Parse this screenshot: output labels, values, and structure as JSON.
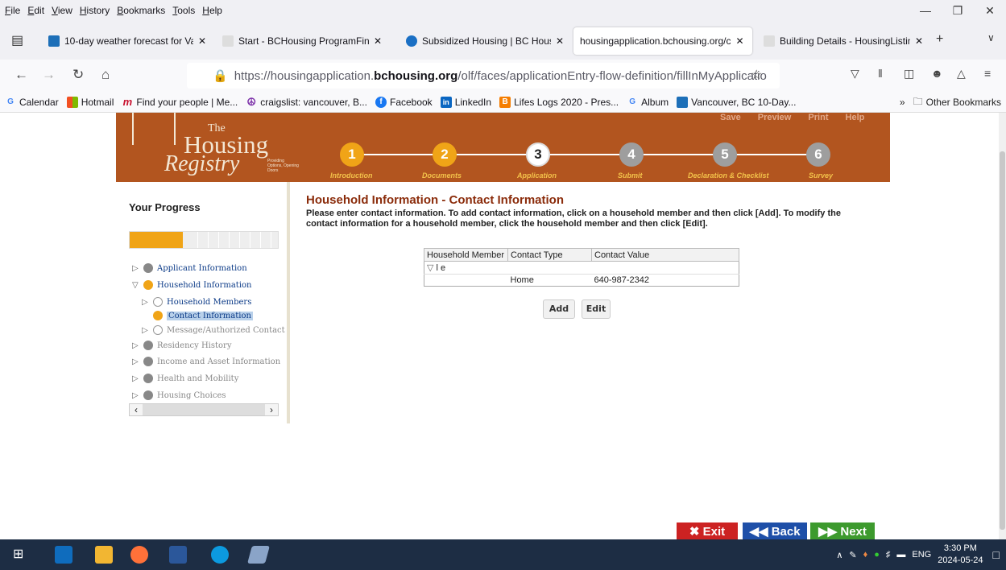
{
  "menubar": {
    "items": [
      "File",
      "Edit",
      "View",
      "History",
      "Bookmarks",
      "Tools",
      "Help"
    ]
  },
  "tabs": [
    {
      "title": "10-day weather forecast for Van",
      "color": "#1d6fb8"
    },
    {
      "title": "Start - BCHousing ProgramFind",
      "color": "#aaaaaa"
    },
    {
      "title": "Subsidized Housing | BC Housin",
      "color": "#1a6fc4"
    },
    {
      "title": "housingapplication.bchousing.org/c",
      "color": "#ffffff"
    },
    {
      "title": "Building Details - HousingListin",
      "color": "#aaaaaa"
    }
  ],
  "url": {
    "prefix": "https://housingapplication.",
    "domain": "bchousing.org",
    "path": "/olf/faces/applicationEntry-flow-definition/fillInMyApplicatio"
  },
  "bookmarks": [
    {
      "label": "Calendar",
      "icon": "G",
      "color": "#4285f4"
    },
    {
      "label": "Hotmail",
      "icon": "",
      "color": "#f25022"
    },
    {
      "label": "Find your people | Me...",
      "icon": "m",
      "color": "#c8102e"
    },
    {
      "label": "craigslist: vancouver, B...",
      "icon": "☮",
      "color": "#7b2fa8"
    },
    {
      "label": "Facebook",
      "icon": "f",
      "color": "#1877f2"
    },
    {
      "label": "LinkedIn",
      "icon": "in",
      "color": "#0a66c2"
    },
    {
      "label": "Lifes Logs 2020 - Pres...",
      "icon": "B",
      "color": "#f57d00"
    },
    {
      "label": "Album",
      "icon": "G",
      "color": "#4285f4"
    },
    {
      "label": "Vancouver, BC 10-Day...",
      "icon": "",
      "color": "#1d6fb8"
    }
  ],
  "other_bookmarks": "Other Bookmarks",
  "banner": {
    "logo_the": "The",
    "logo_housing": "Housing",
    "logo_registry": "Registry",
    "logo_tagline": "Providing Options, Opening Doors",
    "top_links": [
      "Save",
      "Preview",
      "Print",
      "Help"
    ]
  },
  "steps": [
    {
      "num": "1",
      "label": "Introduction",
      "state": "done"
    },
    {
      "num": "2",
      "label": "Documents",
      "state": "done"
    },
    {
      "num": "3",
      "label": "Application",
      "state": "current"
    },
    {
      "num": "4",
      "label": "Submit",
      "state": "todo"
    },
    {
      "num": "5",
      "label": "Declaration & Checklist",
      "state": "todo"
    },
    {
      "num": "6",
      "label": "Survey",
      "state": "todo"
    }
  ],
  "sidebar": {
    "title": "Your Progress",
    "progress_fraction": 0.36,
    "items": [
      "Applicant Information",
      "Household Information",
      "Household Members",
      "Contact Information",
      "Message/Authorized Contact",
      "Residency History",
      "Income and Asset Information",
      "Health and Mobility",
      "Housing Choices"
    ]
  },
  "main": {
    "title": "Household Information - Contact Information",
    "instructions": "Please enter contact information. To add contact information, click on a household member and then click [Add]. To modify the contact information for a household member, click the household member and then click [Edit].",
    "table": {
      "headers": [
        "Household Member",
        "Contact Type",
        "Contact Value"
      ],
      "member": "l e",
      "rows": [
        {
          "type": "Home",
          "value": "640-987-2342"
        }
      ]
    },
    "add_label": "Add",
    "edit_label": "Edit"
  },
  "nav": {
    "exit": "Exit",
    "back": "Back",
    "next": "Next"
  },
  "taskbar": {
    "lang": "ENG",
    "time": "3:30 PM",
    "date": "2024-05-24"
  }
}
